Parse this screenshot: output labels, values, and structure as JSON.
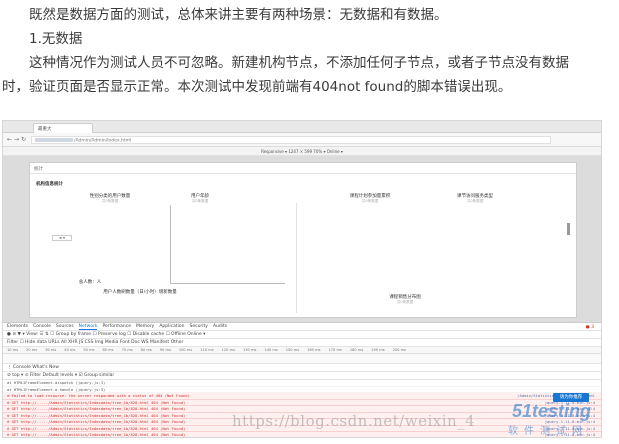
{
  "article": {
    "line1": "既然是数据方面的测试，总体来讲主要有两种场景：无数据和有数据。",
    "line2": "1.无数据",
    "line3": "这种情况作为测试人员不可忽略。新建机构节点，不添加任何子节点，或者子节点没有数据",
    "line4": "时，验证页面是否显示正常。本次测试中发现前端有404not found的脚本错误出现。"
  },
  "browser": {
    "tab_label": "最重大",
    "url_path": "/Admin/Admin/Index.html",
    "device_toolbar": "Responsive ▾   1247  ×  599   70% ▾   Online ▾"
  },
  "app": {
    "header": "统计",
    "section_title": "机构信息统计",
    "charts": [
      {
        "title": "性别分类的用户数量",
        "sub": "共0条数据"
      },
      {
        "title": "用户年龄",
        "sub": "共0条数据"
      },
      {
        "title": "课程计划参加量累积",
        "sub": "共0条数据"
      },
      {
        "title": "课节访问服务类型",
        "sub": "共0条数据"
      },
      {
        "title": "用户人数刷数量（日/小时）增新数量",
        "sub": ""
      },
      {
        "title": "课程销售分布图",
        "sub": "共0条数据"
      }
    ],
    "legend_small": "总人数：人"
  },
  "devtools": {
    "tabs": [
      "Elements",
      "Console",
      "Sources",
      "Network",
      "Performance",
      "Memory",
      "Application",
      "Security",
      "Audits"
    ],
    "active_tab": "Network",
    "error_count": "● 3",
    "toolbar2": "●  ⊘  ▼ ▾   View: ☰ ⇅   ☐ Group by frame  ☐ Preserve log  ☐ Disable cache  ☐ Offline  Online ▾",
    "filter_row": "Filter        ☐ Hide data URLs  All  XHR  JS  CSS  Img  Media  Font  Doc  WS  Manifest  Other",
    "timeline_ticks": [
      "10 ms",
      "20 ms",
      "30 ms",
      "40 ms",
      "50 ms",
      "60 ms",
      "70 ms",
      "80 ms",
      "90 ms",
      "100 ms",
      "110 ms",
      "120 ms",
      "130 ms",
      "140 ms",
      "150 ms",
      "160 ms",
      "170 ms",
      "180 ms",
      "190 ms",
      "200 ms"
    ],
    "drawer_tabs": "⋮  Console   What's New",
    "console_filter": "⊘  top   ▾   ⊙  Filter                                  Default levels ▾   ☑ Group similar",
    "log_lines": [
      {
        "text": "at HTMLIFrameElement.dispatch (jquery.js:3)",
        "src": "",
        "err": false
      },
      {
        "text": "at HTMLIFrameElement.a.handle (jquery.js:3)",
        "src": "",
        "err": false
      },
      {
        "text": "⊗ Failed to load resource: the server responded with a status of 404 (Not Found)",
        "src": "/Admin/Statistics/tree_1b/828.html",
        "err": true
      },
      {
        "text": "⊗ GET http://...../Admin/Statistics/Indexdata/tree_1b/828.html 404 (Not Found)",
        "src": "jquery-1.11.0.min.js:4",
        "err": true
      },
      {
        "text": "⊗ GET http://...../Admin/Statistics/Indexdata/tree_1b/828.html 404 (Not Found)",
        "src": "jquery-1.11.0.min.js:4",
        "err": true
      },
      {
        "text": "⊗ GET http://...../Admin/Statistics/Indexdata/tree_1b/828.html 404 (Not Found)",
        "src": "jquery-1.11.0.min.js:4",
        "err": true
      },
      {
        "text": "⊗ GET http://...../Admin/Statistics/Indexdata/tree_1b/828.html 404 (Not Found)",
        "src": "jquery-1.11.0.min.js:4",
        "err": true
      },
      {
        "text": "⊗ GET http://...../Admin/Statistics/Indexdata/tree_1b/828.html 404 (Not Found)",
        "src": "jquery-1.11.0.min.js:4",
        "err": true
      },
      {
        "text": "⊗ GET http://...../Admin/Statistics/Indexdata/tree_1b/828.html 404 (Not Found)",
        "src": "jquery-1.11.0.min.js:4",
        "err": true
      }
    ],
    "badge": "请为你推荐"
  },
  "watermark": {
    "url": "https://blog.csdn.net/weixin_4",
    "logo": "51testing",
    "logo_sub": "软件测试网"
  }
}
